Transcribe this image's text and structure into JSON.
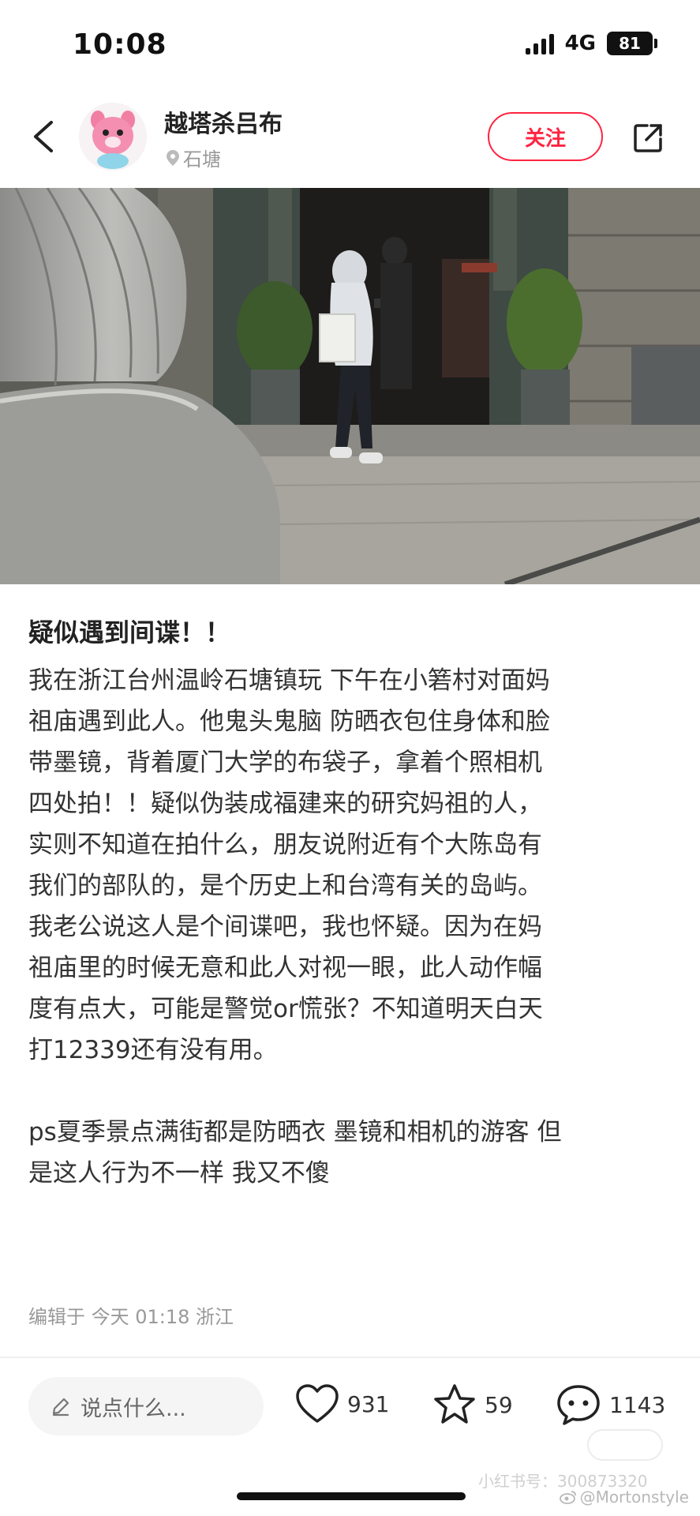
{
  "status_bar": {
    "time": "10:08",
    "network": "4G",
    "battery": "81",
    "icons": [
      "signal-icon",
      "battery-icon"
    ]
  },
  "header": {
    "author_name": "越塔杀吕布",
    "location": "石塘",
    "follow_label": "关注",
    "icons": [
      "back-arrow-icon",
      "avatar-pink-creature",
      "location-pin-icon",
      "share-icon"
    ]
  },
  "photo": {
    "icons": [
      "street-photo-person-with-hood"
    ]
  },
  "note": {
    "title": "疑似遇到间谍！！",
    "body_lines": [
      "我在浙江台州温岭石塘镇玩 下午在小箬村对面妈",
      "祖庙遇到此人。他鬼头鬼脑 防晒衣包住身体和脸",
      "带墨镜，背着厦门大学的布袋子，拿着个照相机",
      "四处拍！！疑似伪装成福建来的研究妈祖的人，",
      "实则不知道在拍什么，朋友说附近有个大陈岛有",
      "我们的部队的，是个历史上和台湾有关的岛屿。",
      "我老公说这人是个间谍吧，我也怀疑。因为在妈",
      "祖庙里的时候无意和此人对视一眼，此人动作幅",
      "度有点大，可能是警觉or慌张？不知道明天白天",
      "打12339还有没有用。"
    ],
    "ps_lines": [
      "ps夏季景点满街都是防晒衣 墨镜和相机的游客 但",
      "是这人行为不一样 我又不傻"
    ],
    "meta": "编辑于 今天 01:18 浙江"
  },
  "bottom_bar": {
    "comment_placeholder": "说点什么...",
    "likes": "931",
    "collects": "59",
    "comments": "1143",
    "icons": [
      "pencil-icon",
      "heart-icon",
      "star-icon",
      "comment-bubble-icon"
    ]
  },
  "watermarks": {
    "xhs_id": "小红书号：300873320",
    "weibo": "@Mortonstyle"
  },
  "colors": {
    "accent": "#ff2442",
    "text": "#333333",
    "muted": "#999999"
  }
}
